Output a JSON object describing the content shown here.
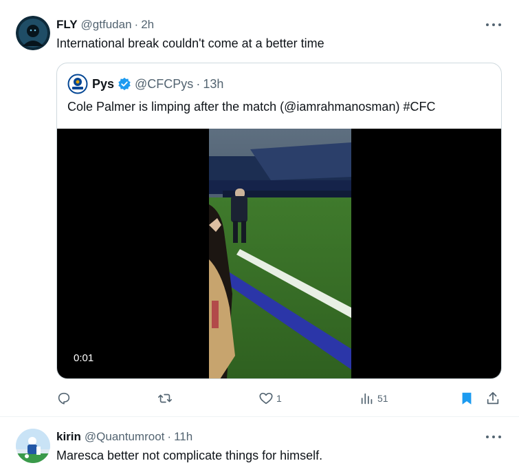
{
  "tweet1": {
    "name": "FLY",
    "handle": "@gtfudan",
    "sep": "·",
    "time": "2h",
    "text": "International break couldn't come at a better time"
  },
  "quote": {
    "name": "Pys",
    "handle": "@CFCPys",
    "sep": "·",
    "time": "13h",
    "text": "Cole Palmer is limping after the match (@iamrahmanosman) #CFC",
    "video_time": "0:01"
  },
  "actions": {
    "likes": "1",
    "views": "51"
  },
  "tweet2": {
    "name": "kirin",
    "handle": "@Quantumroot",
    "sep": "·",
    "time": "11h",
    "text": "Maresca better not complicate things for himself."
  },
  "colors": {
    "accent": "#1d9bf0",
    "secondary_text": "#536471",
    "border": "#cfd9de"
  },
  "icons": [
    "more-icon",
    "verified-icon",
    "reply-icon",
    "retweet-icon",
    "like-icon",
    "views-icon",
    "bookmark-icon",
    "share-icon"
  ]
}
